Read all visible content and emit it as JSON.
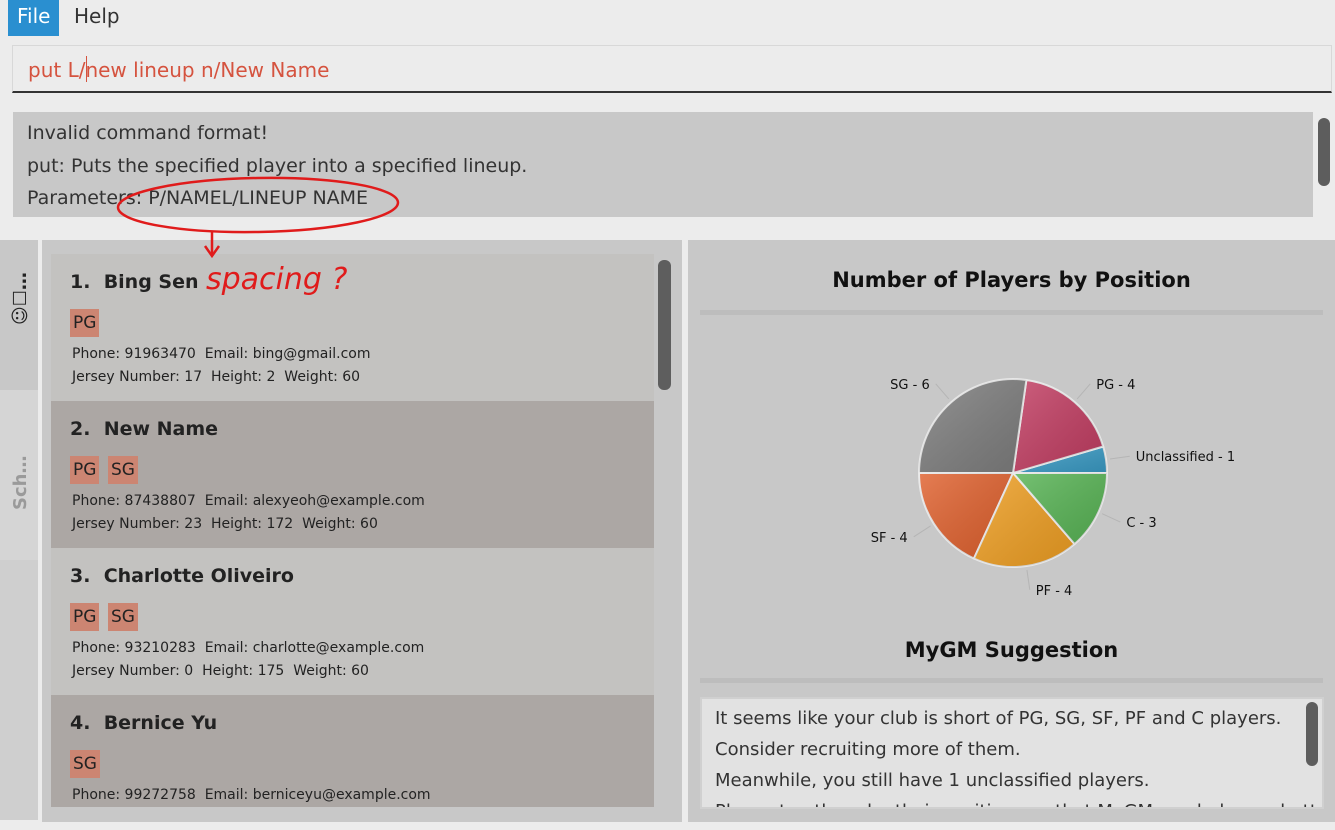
{
  "menu": {
    "file": "File",
    "help": "Help"
  },
  "command": {
    "value": "put L/new lineup n/New Name"
  },
  "result": {
    "lines": [
      "Invalid command format!",
      "put: Puts the specified player into a specified lineup.",
      "Parameters: P/NAMEL/LINEUP NAME"
    ]
  },
  "annotation": {
    "text": "spacing ?"
  },
  "tabs": {
    "players_icons": "☺☐…",
    "schedule": "Sch…"
  },
  "players": [
    {
      "index": "1.",
      "name": "Bing Sen",
      "tags": [
        "PG"
      ],
      "phone": "Phone: 91963470",
      "email": "Email: bing@gmail.com",
      "jersey": "Jersey Number: 17",
      "height": "Height: 2",
      "weight": "Weight: 60"
    },
    {
      "index": "2.",
      "name": "New Name",
      "tags": [
        "PG",
        "SG"
      ],
      "phone": "Phone: 87438807",
      "email": "Email: alexyeoh@example.com",
      "jersey": "Jersey Number: 23",
      "height": "Height: 172",
      "weight": "Weight: 60"
    },
    {
      "index": "3.",
      "name": "Charlotte Oliveiro",
      "tags": [
        "PG",
        "SG"
      ],
      "phone": "Phone: 93210283",
      "email": "Email: charlotte@example.com",
      "jersey": "Jersey Number: 0",
      "height": "Height: 175",
      "weight": "Weight: 60"
    },
    {
      "index": "4.",
      "name": "Bernice Yu",
      "tags": [
        "SG"
      ],
      "phone": "Phone: 99272758",
      "email": "Email: berniceyu@example.com",
      "jersey": "",
      "height": "",
      "weight": ""
    }
  ],
  "chart_title": "Number of Players by Position",
  "chart_data": {
    "type": "pie",
    "title": "Number of Players by Position",
    "slices": [
      {
        "label": "Unclassified - 1",
        "value": 1,
        "color": "#3a9bc5"
      },
      {
        "label": "PG - 4",
        "value": 4,
        "color": "#c23d62"
      },
      {
        "label": "SG - 6",
        "value": 6,
        "color": "#7e7e7e"
      },
      {
        "label": "SF - 4",
        "value": 4,
        "color": "#e0612e"
      },
      {
        "label": "PF - 4",
        "value": 4,
        "color": "#ef9f23"
      },
      {
        "label": "C - 3",
        "value": 3,
        "color": "#58b455"
      }
    ]
  },
  "suggestion": {
    "title": "MyGM Suggestion",
    "lines": [
      "It seems like your club is short of PG, SG, SF, PF and C players.",
      "Consider recruiting more of them.",
      "Meanwhile, you still have 1 unclassified players.",
      "Please tag them by their positions so that MyGM can help you better."
    ]
  }
}
